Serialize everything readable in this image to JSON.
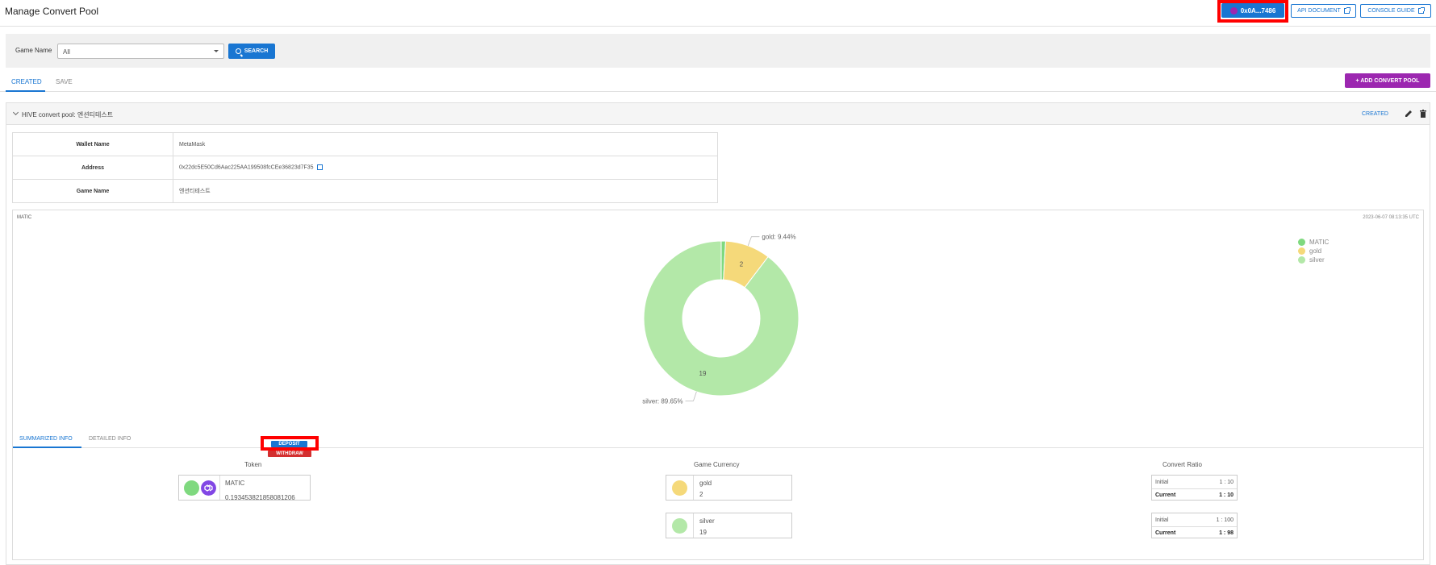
{
  "header": {
    "title": "Manage Convert Pool",
    "wallet_label": "0x0A...7486",
    "api_doc_label": "API DOCUMENT",
    "console_guide_label": "CONSOLE GUIDE"
  },
  "filter": {
    "label": "Game Name",
    "selected": "All",
    "search_label": "SEARCH"
  },
  "tabs": [
    {
      "label": "CREATED",
      "active": true
    },
    {
      "label": "SAVE",
      "active": false
    }
  ],
  "add_button_label": "+ ADD CONVERT POOL",
  "pool": {
    "title": "HIVE convert pool: 엔션티테스트",
    "status": "CREATED",
    "info": [
      {
        "key": "Wallet Name",
        "value": "MetaMask"
      },
      {
        "key": "Address",
        "value": "0x22dc5E50Cd6Aac225AA199508fcCEe36823d7F35"
      },
      {
        "key": "Game Name",
        "value": "엔션티테스트"
      }
    ]
  },
  "chart_data": {
    "type": "pie",
    "title": "MATIC",
    "timestamp": "2023-06-07 08:13:35 UTC",
    "categories": [
      "MATIC",
      "gold",
      "silver"
    ],
    "values": [
      0.19345382185808122,
      2,
      19
    ],
    "percent_labels": [
      "",
      "gold: 9.44%",
      "silver: 89.65%"
    ],
    "value_labels": [
      "",
      "2",
      "19"
    ],
    "legend_position": "top-right",
    "colors": [
      "#7fd97f",
      "#f5d97a",
      "#b3e8a8"
    ]
  },
  "sub_tabs": [
    {
      "label": "SUMMARIZED INFO",
      "active": true
    },
    {
      "label": "DETAILED INFO",
      "active": false
    }
  ],
  "summary": {
    "token_head": "Token",
    "currency_head": "Game Currency",
    "ratio_head": "Convert Ratio",
    "token": {
      "name": "MATIC",
      "amount": "0.193453821858081206",
      "deposit_label": "DEPOSIT",
      "withdraw_label": "WITHDRAW",
      "color": "#7fd97f"
    },
    "currencies": [
      {
        "name": "gold",
        "amount": "2",
        "color": "#f5d97a"
      },
      {
        "name": "silver",
        "amount": "19",
        "color": "#b3e8a8"
      }
    ],
    "ratios": [
      {
        "initial_label": "Initial",
        "initial": "1 : 10",
        "current_label": "Current",
        "current": "1 : 10"
      },
      {
        "initial_label": "Initial",
        "initial": "1 : 100",
        "current_label": "Current",
        "current": "1 : 98"
      }
    ]
  }
}
